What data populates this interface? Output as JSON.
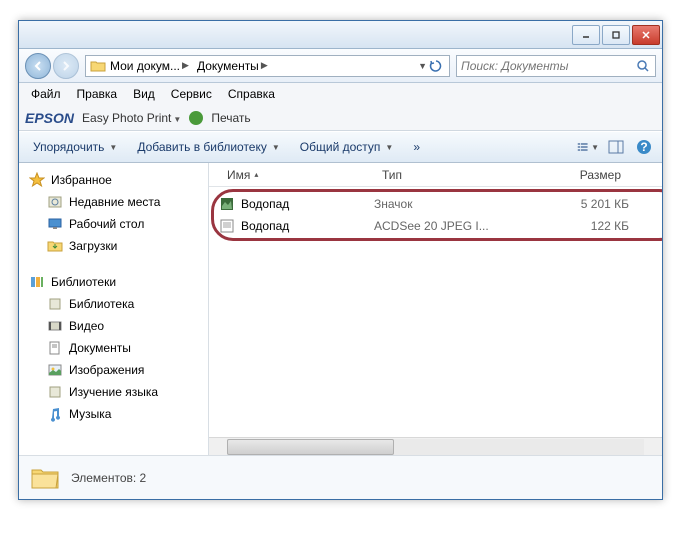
{
  "titlebar": {
    "minimize": "_",
    "maximize": "□",
    "close": "×"
  },
  "breadcrumbs": [
    {
      "label": "Мои докум..."
    },
    {
      "label": "Документы"
    }
  ],
  "search": {
    "placeholder": "Поиск: Документы"
  },
  "menu": {
    "file": "Файл",
    "edit": "Правка",
    "view": "Вид",
    "service": "Сервис",
    "help": "Справка"
  },
  "epson": {
    "brand": "EPSON",
    "easy": "Easy Photo Print",
    "print": "Печать"
  },
  "toolbar": {
    "organize": "Упорядочить",
    "addlib": "Добавить в библиотеку",
    "share": "Общий доступ"
  },
  "sidebar": {
    "fav": "Избранное",
    "fav_items": [
      "Недавние места",
      "Рабочий стол",
      "Загрузки"
    ],
    "lib": "Библиотеки",
    "lib_items": [
      "Библиотека",
      "Видео",
      "Документы",
      "Изображения",
      "Изучение языка",
      "Музыка"
    ]
  },
  "columns": {
    "name": "Имя",
    "type": "Тип",
    "size": "Размер"
  },
  "files": [
    {
      "name": "Водопад",
      "type": "Значок",
      "size": "5 201 КБ"
    },
    {
      "name": "Водопад",
      "type": "ACDSee 20 JPEG I...",
      "size": "122 КБ"
    }
  ],
  "status": {
    "count": "Элементов: 2"
  }
}
